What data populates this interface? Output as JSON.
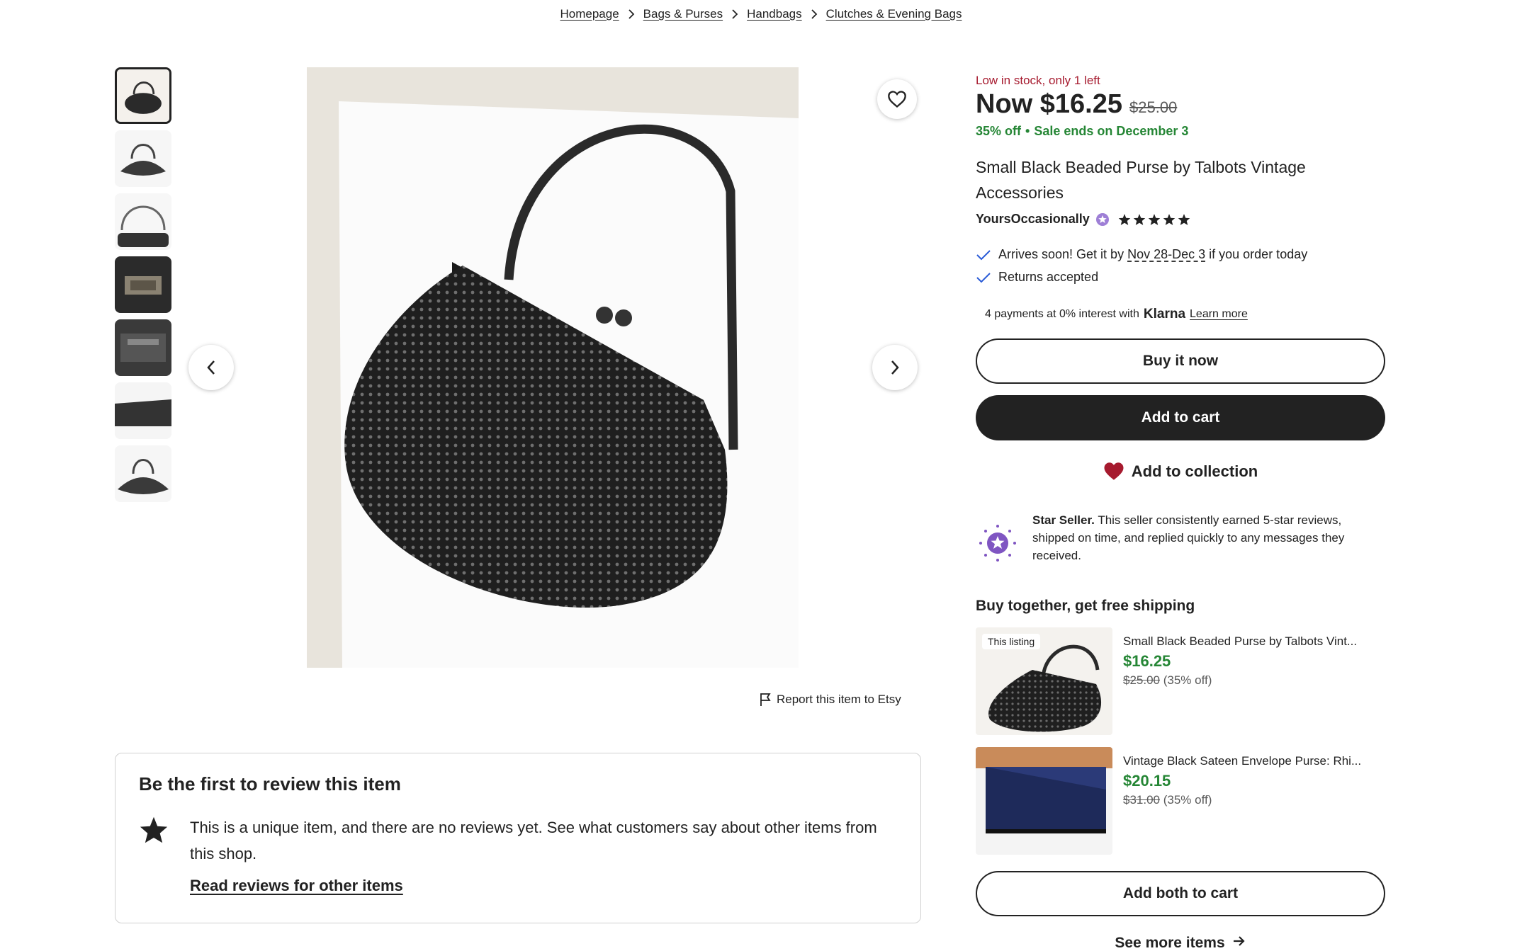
{
  "breadcrumb": [
    "Homepage",
    "Bags & Purses",
    "Handbags",
    "Clutches & Evening Bags"
  ],
  "gallery": {
    "thumbnail_count": 7,
    "prev_icon": "chevron-left-icon",
    "next_icon": "chevron-right-icon",
    "favorite_icon": "heart-outline-icon"
  },
  "report": {
    "label": "Report this item to Etsy",
    "icon": "flag-icon"
  },
  "reviews": {
    "title": "Be the first to review this item",
    "body": "This is a unique item, and there are no reviews yet. See what customers say about other items from this shop.",
    "link": "Read reviews for other items",
    "icon": "star-icon"
  },
  "listing": {
    "stock": "Low in stock, only 1 left",
    "price_now": "Now $16.25",
    "price_original": "$25.00",
    "discount": "35% off",
    "sale_ends": "Sale ends on December 3",
    "title": "Small Black Beaded Purse by Talbots Vintage Accessories",
    "shop_name": "YoursOccasionally",
    "rating": 5,
    "shipping": {
      "prefix": "Arrives soon! Get it by ",
      "dates": "Nov 28-Dec 3",
      "suffix": " if you order today"
    },
    "returns": "Returns accepted",
    "klarna": {
      "text": "4 payments at 0% interest with",
      "brand": "Klarna",
      "link": "Learn more"
    },
    "buy_now": "Buy it now",
    "add_to_cart": "Add to cart",
    "add_to_collection": "Add to collection"
  },
  "star_seller": {
    "title": "Star Seller.",
    "text": "This seller consistently earned 5-star reviews, shipped on time, and replied quickly to any messages they received."
  },
  "bundle": {
    "title": "Buy together, get free shipping",
    "items": [
      {
        "tag": "This listing",
        "name": "Small Black Beaded Purse by Talbots Vint...",
        "price": "$16.25",
        "original": "$25.00",
        "discount": "(35% off)"
      },
      {
        "tag": "",
        "name": "Vintage Black Sateen Envelope Purse: Rhi...",
        "price": "$20.15",
        "original": "$31.00",
        "discount": "(35% off)"
      }
    ],
    "add_both": "Add both to cart"
  },
  "see_more": "See more items",
  "colors": {
    "accent_red": "#a61a2e",
    "sale_green": "#258635",
    "dark": "#222222",
    "star_purple": "#7f55c2",
    "heart_red": "#a61a2e"
  }
}
